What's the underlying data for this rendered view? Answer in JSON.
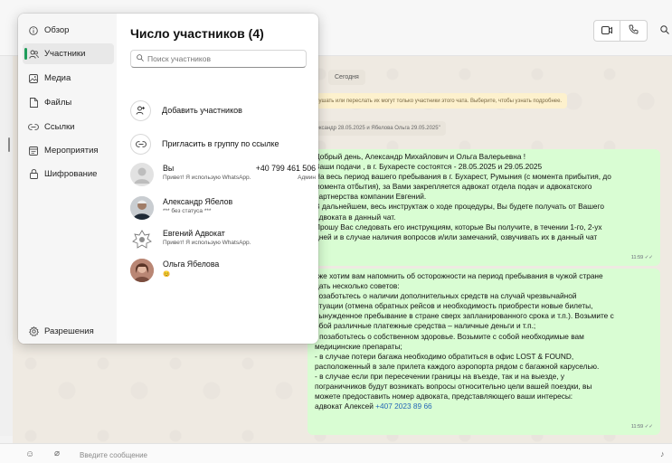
{
  "header": {
    "video_icon": "video-icon",
    "call_icon": "phone-icon",
    "search_icon": "search-icon"
  },
  "chat": {
    "date_chip": "Сегодня",
    "encryption_notice": "слушать или переслать их могут только участники этого чата. Выберите, чтобы узнать подробнее.",
    "system_message": "лександр 28.05.2025 и Ябелова Ольга 29.05.2025\"",
    "message1": {
      "lines": [
        "Добрый день, Александр Михайлович и Ольга Валерьевна   !",
        "Ваши подачи  , в г. Бухаресте состоятся - 28.05.2025 и 29.05.2025",
        "На весь период вашего пребывания в г. Бухарест, Румыния (с момента прибытия, до",
        "момента отбытия), за Вами закрепляется адвокат отдела подач и адвокатского",
        "партнерства компании Евгений.",
        "В дальнейшем, весь инструктаж о ходе процедуры, Вы будете получать от Вашего",
        "адвоката в данный чат.",
        "Прошу Вас следовать его инструкциям, которые Вы получите, в течении 1-го, 2-ух",
        "дней и в случае наличия вопросов и/или замечаний, озвучивать их в данный чат"
      ],
      "time": "11:59"
    },
    "message2": {
      "lines": [
        "кже хотим вам напомнить об осторожности на период пребывания в чужой стране",
        " дать несколько советов:",
        " позаботьтесь о наличии дополнительных средств на случай чрезвычайной",
        "итуации (отмена обратных рейсов и необходимость приобрести новые билеты,",
        "вынужденное пребывание в стране сверх запланированного срока и т.п.). Возьмите с",
        "обой различные платежные средства – наличные деньги и т.п.;",
        "- позаботьтесь о собственном здоровье. Возьмите с собой необходимые вам",
        "медицинские препараты;",
        "- в случае потери багажа необходимо обратиться в офис LOST & FOUND,",
        "расположенный в зале прилета каждого аэропорта рядом с багажной каруселью.",
        "- в случае если при пересечении границы на въезде, так и на выезде, у",
        "пограничников будут возникать вопросы относительно цели вашей поездки, вы",
        "можете предоставить номер адвоката, представляющего ваши интересы:"
      ],
      "last_line_prefix": "адвокат Алексей ",
      "phone": "+407 2023 89 66",
      "time": "11:59"
    }
  },
  "composer": {
    "placeholder": "Введите сообщение"
  },
  "panel": {
    "nav": [
      {
        "label": "Обзор",
        "icon": "info-icon",
        "glyph": "ⓘ"
      },
      {
        "label": "Участники",
        "icon": "people-icon",
        "glyph": "☉"
      },
      {
        "label": "Медиа",
        "icon": "media-icon",
        "glyph": "▣"
      },
      {
        "label": "Файлы",
        "icon": "file-icon",
        "glyph": "▯"
      },
      {
        "label": "Ссылки",
        "icon": "link-icon",
        "glyph": "⊖"
      },
      {
        "label": "Мероприятия",
        "icon": "calendar-icon",
        "glyph": "▤"
      },
      {
        "label": "Шифрование",
        "icon": "lock-icon",
        "glyph": "⊓"
      }
    ],
    "settings": {
      "label": "Разрешения",
      "icon": "settings-icon",
      "glyph": "⚙"
    },
    "title": "Число участников (4)",
    "search_placeholder": "Поиск участников",
    "add_label": "Добавить участников",
    "invite_label": "Пригласить в группу по ссылке",
    "members": [
      {
        "name": "Вы",
        "phone": "+40 799 461 506",
        "status": "Привет! Я использую WhatsApp.",
        "role": "Админ",
        "avatar": "default"
      },
      {
        "name": "Александр Ябелов",
        "phone": "",
        "status": "*** без статуса ***",
        "role": "",
        "avatar": "photo-man"
      },
      {
        "name": "Евгений Адвокат",
        "phone": "",
        "status": "Привет! Я использую WhatsApp.",
        "role": "",
        "avatar": "emblem"
      },
      {
        "name": "Ольга Ябелова",
        "phone": "",
        "status": "😊",
        "role": "",
        "avatar": "photo-woman"
      }
    ]
  },
  "colors": {
    "accent": "#1f9c5a",
    "bubble": "#d9fdd3",
    "notice": "#fdf1cd"
  }
}
